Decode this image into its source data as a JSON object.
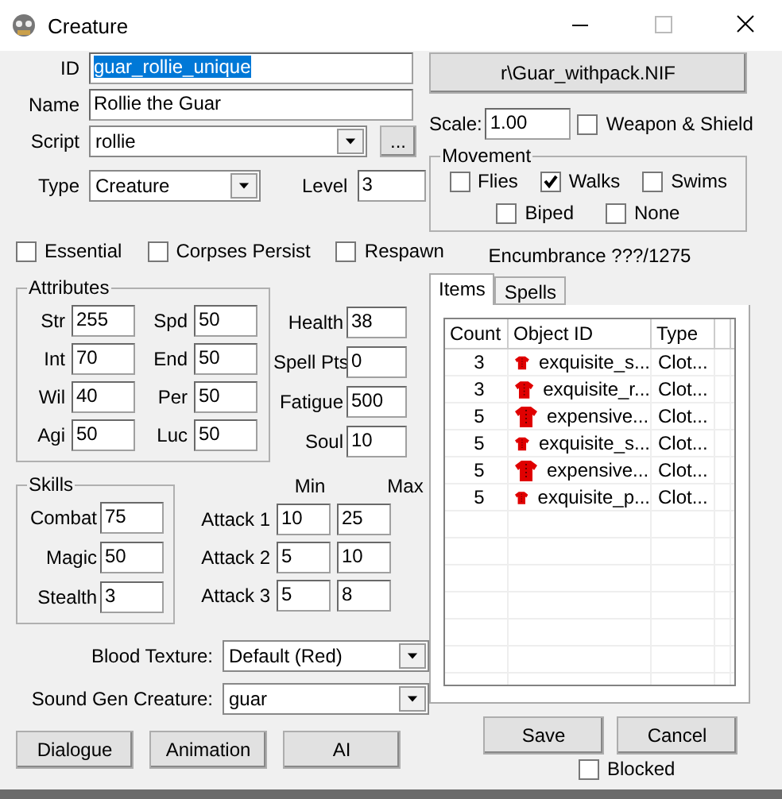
{
  "window": {
    "title": "Creature"
  },
  "id": {
    "label": "ID",
    "value": "guar_rollie_unique",
    "highlighted": true
  },
  "name": {
    "label": "Name",
    "value": "Rollie the Guar"
  },
  "script": {
    "label": "Script",
    "value": "rollie",
    "browse": "..."
  },
  "type": {
    "label": "Type",
    "value": "Creature"
  },
  "level": {
    "label": "Level",
    "value": "3"
  },
  "flags": [
    {
      "label": "Essential",
      "checked": false
    },
    {
      "label": "Corpses Persist",
      "checked": false
    },
    {
      "label": "Respawn",
      "checked": false
    }
  ],
  "attributes": {
    "title": "Attributes",
    "items": [
      {
        "label": "Str",
        "value": "255"
      },
      {
        "label": "Spd",
        "value": "50"
      },
      {
        "label": "Int",
        "value": "70"
      },
      {
        "label": "End",
        "value": "50"
      },
      {
        "label": "Wil",
        "value": "40"
      },
      {
        "label": "Per",
        "value": "50"
      },
      {
        "label": "Agi",
        "value": "50"
      },
      {
        "label": "Luc",
        "value": "50"
      }
    ]
  },
  "stats": [
    {
      "label": "Health",
      "value": "38"
    },
    {
      "label": "Spell Pts",
      "value": "0"
    },
    {
      "label": "Fatigue",
      "value": "500"
    },
    {
      "label": "Soul",
      "value": "10"
    }
  ],
  "skills": {
    "title": "Skills",
    "items": [
      {
        "label": "Combat",
        "value": "75"
      },
      {
        "label": "Magic",
        "value": "50"
      },
      {
        "label": "Stealth",
        "value": "3"
      }
    ]
  },
  "attacks": {
    "min_label": "Min",
    "max_label": "Max",
    "rows": [
      {
        "label": "Attack 1",
        "min": "10",
        "max": "25"
      },
      {
        "label": "Attack 2",
        "min": "5",
        "max": "10"
      },
      {
        "label": "Attack 3",
        "min": "5",
        "max": "8"
      }
    ]
  },
  "blood_texture": {
    "label": "Blood Texture:",
    "value": "Default (Red)"
  },
  "sound_gen": {
    "label": "Sound Gen Creature:",
    "value": "guar"
  },
  "bottom_buttons": [
    "Dialogue",
    "Animation",
    "AI"
  ],
  "model_button": "r\\Guar_withpack.NIF",
  "scale": {
    "label": "Scale:",
    "value": "1.00"
  },
  "weapon_shield": {
    "label": "Weapon & Shield",
    "checked": false
  },
  "movement": {
    "title": "Movement",
    "options": [
      {
        "label": "Flies",
        "checked": false
      },
      {
        "label": "Walks",
        "checked": true
      },
      {
        "label": "Swims",
        "checked": false
      },
      {
        "label": "Biped",
        "checked": false
      },
      {
        "label": "None",
        "checked": false
      }
    ]
  },
  "encumbrance": "Encumbrance ???/1275",
  "tabs": [
    {
      "label": "Items",
      "selected": true
    },
    {
      "label": "Spells",
      "selected": false
    }
  ],
  "inventory": {
    "columns": [
      "Count",
      "Object ID",
      "Type"
    ],
    "rows": [
      {
        "count": "3",
        "object_id": "exquisite_s...",
        "type": "Clot..."
      },
      {
        "count": "3",
        "object_id": "exquisite_r...",
        "type": "Clot..."
      },
      {
        "count": "5",
        "object_id": "expensive...",
        "type": "Clot..."
      },
      {
        "count": "5",
        "object_id": "exquisite_s...",
        "type": "Clot..."
      },
      {
        "count": "5",
        "object_id": "expensive...",
        "type": "Clot..."
      },
      {
        "count": "5",
        "object_id": "exquisite_p...",
        "type": "Clot..."
      }
    ]
  },
  "actions": [
    "Save",
    "Cancel"
  ],
  "blocked": {
    "label": "Blocked",
    "checked": false
  }
}
